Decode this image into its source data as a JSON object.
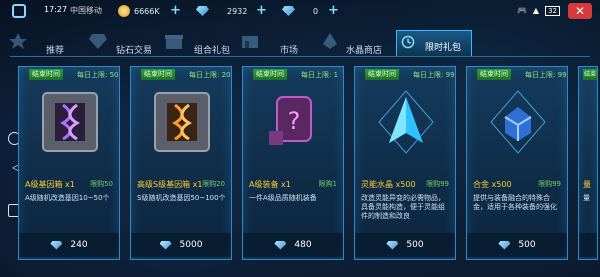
{
  "status": {
    "time": "17:27",
    "carrier": "中国移动",
    "battery": "32"
  },
  "resources": {
    "gold": "6666K",
    "gems": "2932",
    "other": "0"
  },
  "tabs": [
    {
      "label": "推荐",
      "icon": "star-icon"
    },
    {
      "label": "钻石交易",
      "icon": "diamond-icon"
    },
    {
      "label": "组合礼包",
      "icon": "gift-icon"
    },
    {
      "label": "市场",
      "icon": "market-icon"
    },
    {
      "label": "水晶商店",
      "icon": "crystal-icon"
    },
    {
      "label": "限时礼包",
      "icon": "clock-icon"
    }
  ],
  "active_tab": "限时礼包",
  "cards": [
    {
      "tag": "结束时间",
      "cap": "每日上限: 50",
      "name": "A级基因箱 x1",
      "limit": "限购50",
      "desc": "A级随机改造基因10~50个",
      "price": "240"
    },
    {
      "tag": "结束时间",
      "cap": "每日上限: 20",
      "name": "高级S级基因箱 x1",
      "limit": "限购20",
      "desc": "S级随机改造基因50~100个",
      "price": "5000"
    },
    {
      "tag": "结束时间",
      "cap": "每日上限: 1",
      "name": "A级装备 x1",
      "limit": "限购1",
      "desc": "一件A级品质随机装备",
      "price": "480"
    },
    {
      "tag": "结束时间",
      "cap": "每日上限: 99",
      "name": "灵能水晶 x500",
      "limit": "限购99",
      "desc": "改造灵能异变的必需物品，具备灵能构造，便于灵能组件的制造和改良",
      "price": "500"
    },
    {
      "tag": "结束时间",
      "cap": "每日上限: 99",
      "name": "合金 x500",
      "limit": "限购99",
      "desc": "提供与装备融合的特殊合金，适用于各种装备的强化",
      "price": "500"
    },
    {
      "tag": "结束",
      "cap": "",
      "name": "量",
      "limit": "",
      "desc": "量",
      "price": ""
    }
  ]
}
